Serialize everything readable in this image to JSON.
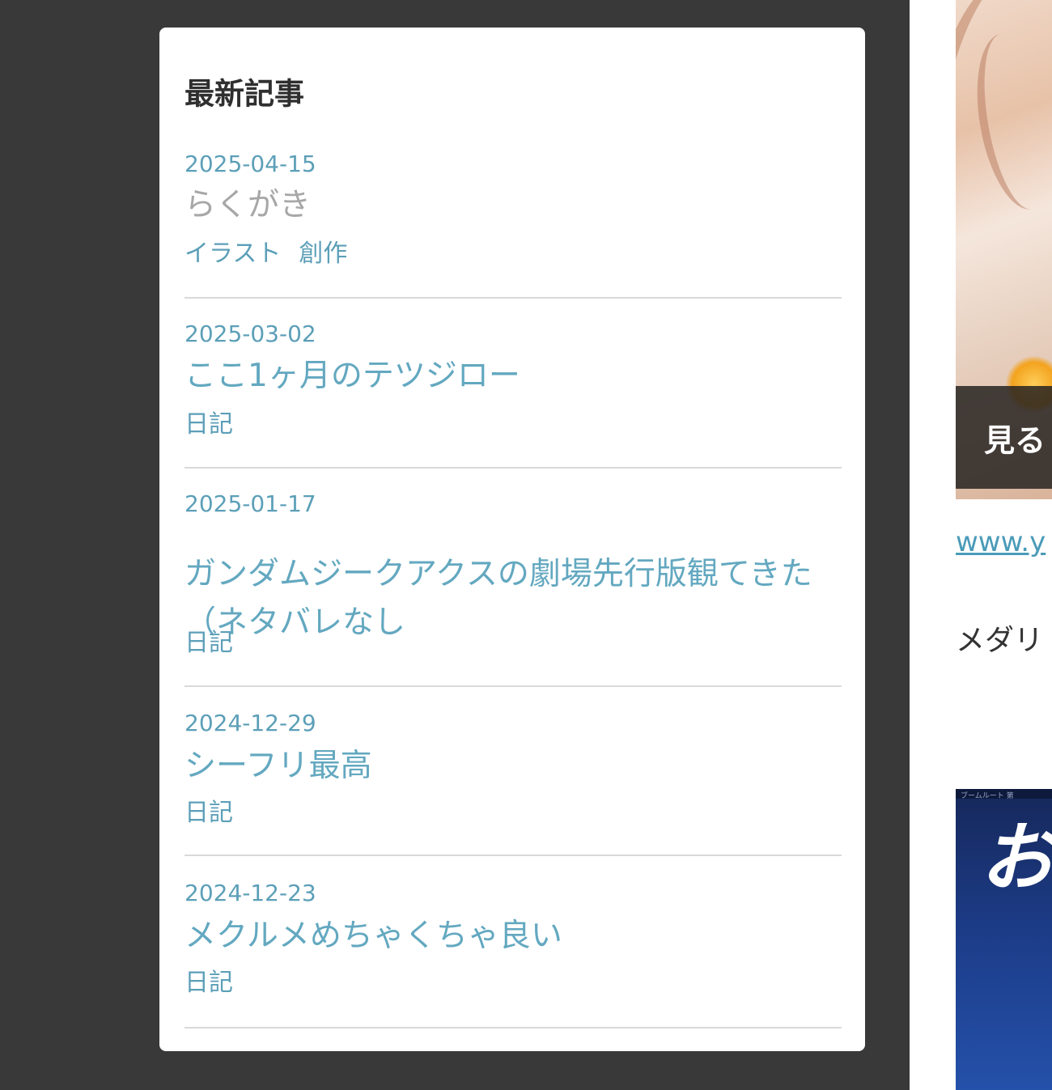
{
  "sidebar": {
    "widget_title": "最新記事",
    "articles": [
      {
        "date": "2025-04-15",
        "title": "らくがき",
        "visited": true,
        "categories": [
          "イラスト",
          "創作"
        ]
      },
      {
        "date": "2025-03-02",
        "title": "ここ1ヶ月のテツジロー",
        "visited": false,
        "categories": [
          "日記"
        ]
      },
      {
        "date": "2025-01-17",
        "title": "ガンダムジークアクスの劇場先行版観てきた（ネタバレなし",
        "visited": false,
        "categories": [
          "日記"
        ]
      },
      {
        "date": "2024-12-29",
        "title": "シーフリ最高",
        "visited": false,
        "categories": [
          "日記"
        ]
      },
      {
        "date": "2024-12-23",
        "title": "メクルメめちゃくちゃ良い",
        "visited": false,
        "categories": [
          "日記"
        ]
      }
    ]
  },
  "main": {
    "thumbnail_overlay_label": "見る",
    "link_text": "www.y",
    "snippet_text": "メダリ",
    "banner_char": "お",
    "banner_strip_text": "ブームルート 第"
  },
  "colors": {
    "page_background": "#393939",
    "widget_background": "#ffffff",
    "link": "#63a8c0",
    "visited_link": "#a7a7a7",
    "meta": "#5c9fb8",
    "heading": "#2f2f2f",
    "divider": "#d9d9d9"
  }
}
